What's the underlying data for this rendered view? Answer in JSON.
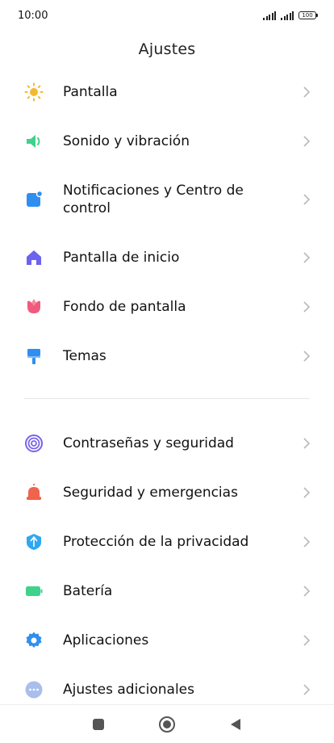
{
  "status_bar": {
    "time": "10:00",
    "battery_level": "100"
  },
  "page": {
    "title": "Ajustes"
  },
  "settings_group_1": [
    {
      "id": "pantalla",
      "label": "Pantalla",
      "icon": "sun-icon",
      "color": "#F5B82E"
    },
    {
      "id": "sonido",
      "label": "Sonido y vibración",
      "icon": "speaker-icon",
      "color": "#3FD28C"
    },
    {
      "id": "notificaciones",
      "label": "Notificaciones y Centro de control",
      "icon": "notification-icon",
      "color": "#2F8FF0"
    },
    {
      "id": "inicio",
      "label": "Pantalla de inicio",
      "icon": "home-icon",
      "color": "#6C63F0"
    },
    {
      "id": "fondo",
      "label": "Fondo de pantalla",
      "icon": "tulip-icon",
      "color": "#F05A7E"
    },
    {
      "id": "temas",
      "label": "Temas",
      "icon": "brush-icon",
      "color": "#2F8FF0"
    }
  ],
  "settings_group_2": [
    {
      "id": "contrasenas",
      "label": "Contraseñas y seguridad",
      "icon": "fingerprint-icon",
      "color": "#7B63E8"
    },
    {
      "id": "emergencias",
      "label": "Seguridad y emergencias",
      "icon": "alarm-icon",
      "color": "#F0634C"
    },
    {
      "id": "privacidad",
      "label": "Protección de la privacidad",
      "icon": "shield-icon",
      "color": "#2FA8F0"
    },
    {
      "id": "bateria",
      "label": "Batería",
      "icon": "battery-icon",
      "color": "#3FD28C"
    },
    {
      "id": "aplicaciones",
      "label": "Aplicaciones",
      "icon": "gear-icon",
      "color": "#2F8FF0"
    },
    {
      "id": "adicionales",
      "label": "Ajustes adicionales",
      "icon": "more-icon",
      "color": "#A9BEEB"
    }
  ],
  "nav_bar": {
    "recents": "recents-icon",
    "home": "home-button-icon",
    "back": "back-icon"
  }
}
